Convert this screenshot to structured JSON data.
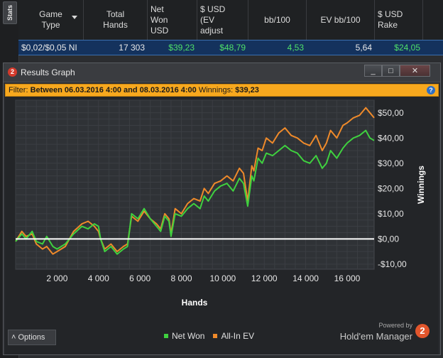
{
  "stats_tab": {
    "label": "Stats"
  },
  "table": {
    "headers": [
      "Game Type",
      "Total Hands",
      "Net Won USD",
      "$ USD (EV adjust",
      "bb/100",
      "EV bb/100",
      "$ USD Rake"
    ],
    "row": {
      "game_type": "$0,02/$0,05 NI",
      "total_hands": "17 303",
      "net_won": "$39,23",
      "ev_adjusted": "$48,79",
      "bb100": "4,53",
      "ev_bb100": "5,64",
      "rake": "$24,05"
    }
  },
  "window": {
    "app_badge": "2",
    "title": "Results Graph",
    "buttons": {
      "minimize": "_",
      "maximize": "□",
      "close": "✕"
    },
    "filter": {
      "prefix": "Filter:",
      "range": "Between 06.03.2016 4:00 and 08.03.2016 4:00",
      "winnings_label": "Winnings:",
      "winnings_value": "$39,23"
    },
    "help_icon": "?"
  },
  "chart_data": {
    "type": "line",
    "xlabel": "Hands",
    "ylabel": "Winnings",
    "xlim": [
      0,
      17303
    ],
    "ylim": [
      -12,
      55
    ],
    "x_ticks": [
      2000,
      4000,
      6000,
      8000,
      10000,
      12000,
      14000,
      16000
    ],
    "x_tick_labels": [
      "2 000",
      "4 000",
      "6 000",
      "8 000",
      "10 000",
      "12 000",
      "14 000",
      "16 000"
    ],
    "y_ticks": [
      -10,
      0,
      10,
      20,
      30,
      40,
      50
    ],
    "y_tick_labels": [
      "-$10,00",
      "$0,00",
      "$10,00",
      "$20,00",
      "$30,00",
      "$40,00",
      "$50,00"
    ],
    "grid": true,
    "zero_line": true,
    "legend_position": "bottom",
    "series": [
      {
        "name": "Net Won",
        "color": "#3fd13f",
        "x": [
          0,
          300,
          500,
          800,
          1000,
          1300,
          1500,
          1800,
          2000,
          2400,
          2800,
          3200,
          3500,
          3800,
          4000,
          4100,
          4300,
          4600,
          4900,
          5200,
          5400,
          5600,
          5900,
          6200,
          6500,
          6800,
          7000,
          7200,
          7400,
          7500,
          7700,
          8000,
          8300,
          8600,
          8900,
          9100,
          9300,
          9600,
          9900,
          10200,
          10500,
          10800,
          11000,
          11200,
          11400,
          11500,
          11700,
          11900,
          12100,
          12400,
          12700,
          13000,
          13300,
          13600,
          13900,
          14200,
          14500,
          14800,
          15000,
          15200,
          15500,
          15800,
          16000,
          16300,
          16600,
          16900,
          17100,
          17303
        ],
        "y": [
          -1,
          2,
          0,
          3,
          -1,
          -2,
          1,
          -3,
          -4,
          -2,
          2,
          5,
          4,
          6,
          5,
          0,
          -5,
          -3,
          -6,
          -4,
          -3,
          10,
          8,
          12,
          8,
          5,
          3,
          9,
          7,
          1,
          10,
          9,
          12,
          14,
          12,
          17,
          15,
          19,
          21,
          22,
          19,
          24,
          22,
          13,
          25,
          23,
          32,
          30,
          34,
          33,
          35,
          37,
          35,
          34,
          31,
          30,
          33,
          28,
          30,
          35,
          32,
          36,
          38,
          40,
          41,
          43,
          40,
          39
        ]
      },
      {
        "name": "All-In EV",
        "color": "#ef8a2a",
        "x": [
          0,
          300,
          500,
          800,
          1000,
          1300,
          1500,
          1800,
          2000,
          2400,
          2800,
          3200,
          3500,
          3800,
          4000,
          4100,
          4300,
          4600,
          4900,
          5200,
          5400,
          5600,
          5900,
          6200,
          6500,
          6800,
          7000,
          7200,
          7400,
          7500,
          7700,
          8000,
          8300,
          8600,
          8900,
          9100,
          9300,
          9600,
          9900,
          10200,
          10500,
          10800,
          11000,
          11200,
          11400,
          11500,
          11700,
          11900,
          12100,
          12400,
          12700,
          13000,
          13300,
          13600,
          13900,
          14200,
          14500,
          14800,
          15000,
          15200,
          15500,
          15800,
          16000,
          16300,
          16600,
          16900,
          17100,
          17303
        ],
        "y": [
          -1,
          3,
          1,
          2,
          -2,
          -4,
          -3,
          -6,
          -5,
          -3,
          3,
          6,
          7,
          5,
          3,
          0,
          -4,
          -2,
          -5,
          -3,
          -2,
          9,
          7,
          11,
          8,
          6,
          4,
          10,
          8,
          2,
          12,
          10,
          14,
          16,
          15,
          20,
          18,
          22,
          23,
          25,
          23,
          28,
          26,
          15,
          29,
          27,
          36,
          35,
          40,
          38,
          42,
          44,
          41,
          40,
          38,
          37,
          41,
          35,
          38,
          43,
          40,
          45,
          46,
          48,
          49,
          52,
          50,
          48
        ]
      }
    ]
  },
  "options": {
    "label": "Options",
    "arrow": "˄"
  },
  "legend": {
    "net_won": "Net Won",
    "allin_ev": "All-In EV"
  },
  "branding": {
    "powered_by": "Powered by",
    "product": "Hold'em Manager",
    "logo": "2"
  }
}
